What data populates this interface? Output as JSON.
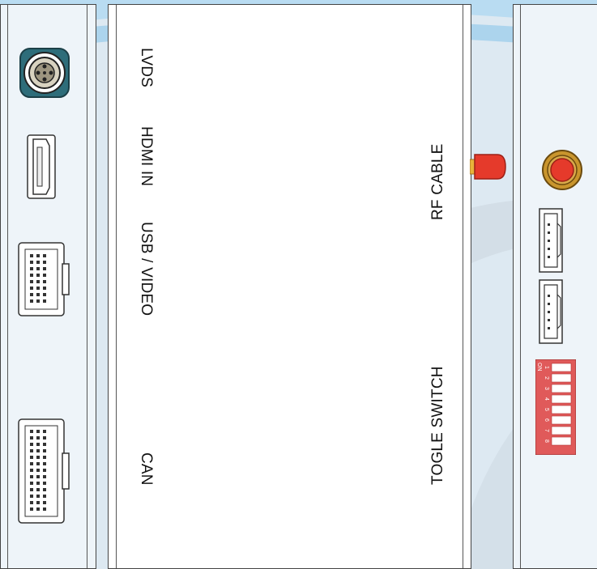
{
  "labels": {
    "lvds": "LVDS",
    "hdmi_in": "HDMI IN",
    "usb_video": "USB / VIDEO",
    "can": "CAN",
    "rf_cable": "RF CABLE",
    "togle_switch": "TOGLE SWITCH"
  },
  "dip_switch": {
    "on_label": "ON",
    "numbers": [
      "1",
      "2",
      "3",
      "4",
      "5",
      "6",
      "7",
      "8"
    ]
  },
  "colors": {
    "panel_border": "#444444",
    "connector_teal": "#2e6d7a",
    "rf_red": "#e53a2b",
    "rf_gold": "#c9952d",
    "dip_red": "#e05a5a",
    "background_swoosh": "#b5d7ee"
  }
}
